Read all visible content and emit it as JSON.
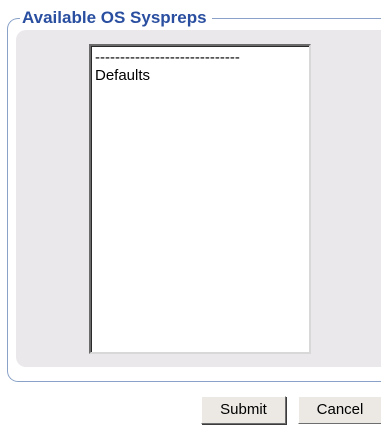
{
  "groupbox": {
    "legend": "Available OS Syspreps"
  },
  "sysprep_list": {
    "options": [
      {
        "label": "-----------------------------",
        "selected": false
      },
      {
        "label": "Defaults",
        "selected": false
      }
    ]
  },
  "actions": {
    "submit_label": "Submit",
    "cancel_label": "Cancel"
  },
  "colors": {
    "legend_text": "#2a4fa0",
    "group_border": "#8aa2c8",
    "group_fill": "#ebe8eb",
    "button_face": "#ece9e4"
  }
}
